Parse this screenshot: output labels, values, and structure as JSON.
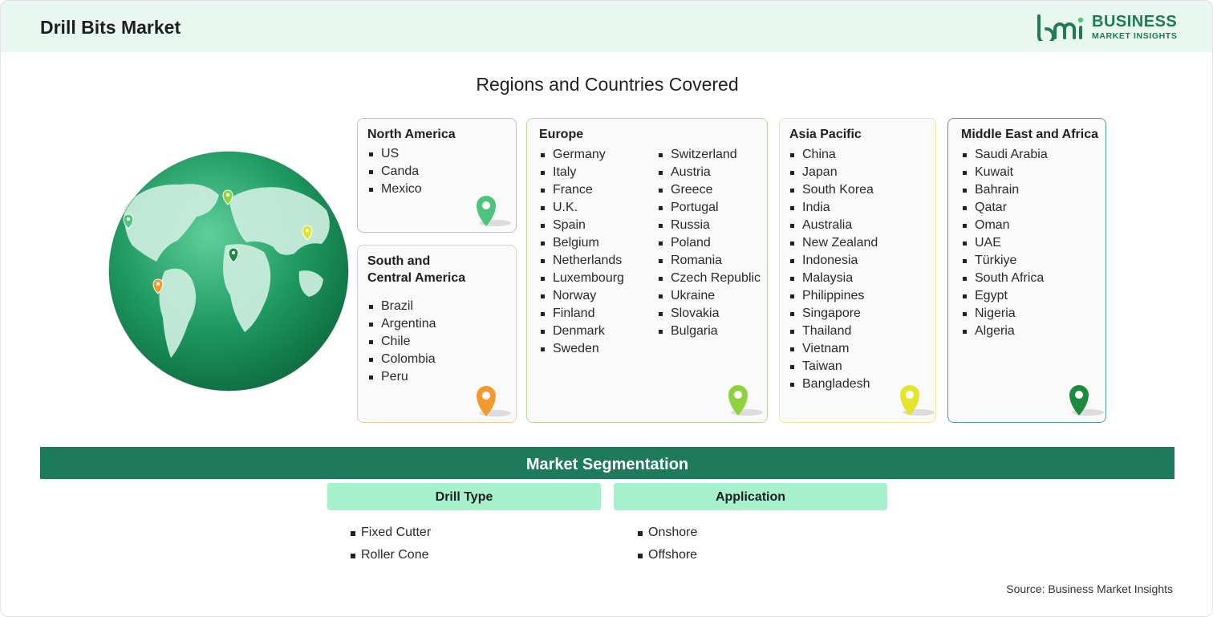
{
  "header": {
    "title": "Drill Bits Market",
    "logo": {
      "mark": "bmi",
      "line1": "BUSINESS",
      "line2": "MARKET INSIGHTS"
    }
  },
  "regions_section": {
    "title": "Regions and Countries Covered",
    "regions": {
      "north_america": {
        "name": "North America",
        "countries": [
          "US",
          "Canda",
          "Mexico"
        ],
        "pin_color": "#4cc47c"
      },
      "south_central_america": {
        "name_line1": "South and",
        "name_line2": "Central America",
        "countries": [
          "Brazil",
          "Argentina",
          "Chile",
          "Colombia",
          "Peru"
        ],
        "pin_color": "#f29a2e"
      },
      "europe": {
        "name": "Europe",
        "countries_col1": [
          "Germany",
          "Italy",
          "France",
          "U.K.",
          "Spain",
          "Belgium",
          "Netherlands",
          "Luxembourg",
          "Norway",
          "Finland",
          "Denmark",
          "Sweden"
        ],
        "countries_col2": [
          "Switzerland",
          "Austria",
          "Greece",
          "Portugal",
          "Russia",
          "Poland",
          "Romania",
          "Czech Republic",
          "Ukraine",
          "Slovakia",
          "Bulgaria"
        ],
        "pin_color": "#8ed23c"
      },
      "asia_pacific": {
        "name": "Asia Pacific",
        "countries": [
          "China",
          "Japan",
          "South Korea",
          "India",
          "Australia",
          "New Zealand",
          "Indonesia",
          "Malaysia",
          "Philippines",
          "Singapore",
          "Thailand",
          "Vietnam",
          "Taiwan",
          "Bangladesh"
        ],
        "pin_color": "#e4e42a"
      },
      "middle_east_africa": {
        "name": "Middle East and Africa",
        "countries": [
          "Saudi Arabia",
          "Kuwait",
          "Bahrain",
          "Qatar",
          "Oman",
          "UAE",
          "Türkiye",
          "South Africa",
          "Egypt",
          "Nigeria",
          "Algeria"
        ],
        "pin_color": "#1e8a3e"
      }
    }
  },
  "segmentation": {
    "title": "Market Segmentation",
    "groups": [
      {
        "heading": "Drill Type",
        "items": [
          "Fixed Cutter",
          "Roller Cone"
        ]
      },
      {
        "heading": "Application",
        "items": [
          "Onshore",
          "Offshore"
        ]
      }
    ]
  },
  "footer": {
    "source": "Source: Business Market Insights"
  },
  "colors": {
    "brand": "#1e7a57",
    "header_bg": "#e8f7ef",
    "segment_bar": "#1d7b5c",
    "segment_head": "#a6f0cc"
  }
}
